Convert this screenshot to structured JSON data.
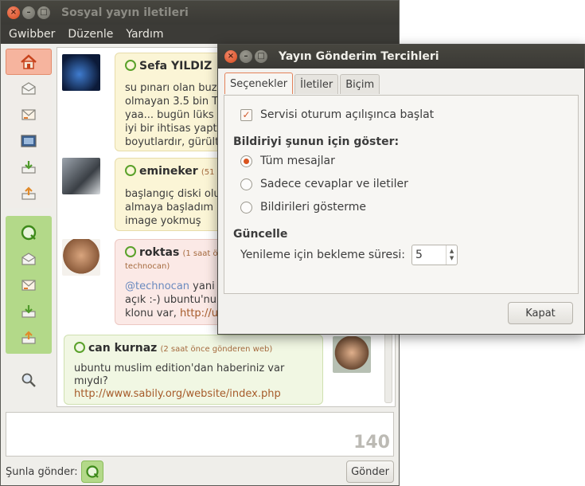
{
  "main_window": {
    "title": "Sosyal yayın iletileri",
    "menu": [
      "Gwibber",
      "Düzenle",
      "Yardım"
    ]
  },
  "messages": [
    {
      "name": "Sefa YILDIZ",
      "meta": "",
      "lines": [
        "su pınarı olan buz",
        "olmayan 3.5 bin T",
        "yaa... bugün lüks",
        "iyi bir ihtisas yapt",
        "boyutlardır, gürült"
      ]
    },
    {
      "name": "emineker",
      "meta": "(51",
      "lines": [
        "başlangıç diski olu",
        "almaya başladım",
        "image yokmuş"
      ]
    },
    {
      "name": "roktas",
      "meta": "(1 saat ö",
      "meta2": "technocan)",
      "lines": [
        "@technocan yani",
        "açık :-) ubuntu'nu",
        "klonu var, http://u"
      ],
      "mention": "@technocan",
      "link_prefix": "klonu var, ",
      "link": "http://u"
    },
    {
      "name": "can kurnaz",
      "meta": "(2 saat önce gönderen web)",
      "lines": [
        "ubuntu muslim edition'dan haberiniz var",
        "mıydı?"
      ],
      "link": "http://www.sabily.org/website/index.php"
    }
  ],
  "compose": {
    "counter": "140"
  },
  "send": {
    "label": "Şunla gönder:",
    "button": "Gönder"
  },
  "dialog": {
    "title": "Yayın Gönderim Tercihleri",
    "tabs": [
      "Seçenekler",
      "İletiler",
      "Biçim"
    ],
    "autostart_label": "Servisi oturum açılışınca başlat",
    "notify_heading": "Bildiriyi şunun için göster:",
    "radio_options": [
      "Tüm mesajlar",
      "Sadece cevaplar ve iletiler",
      "Bildirileri gösterme"
    ],
    "update_heading": "Güncelle",
    "interval_label": "Yenileme için bekleme süresi:",
    "interval_value": "5",
    "close_button": "Kapat"
  },
  "icons": {
    "window_close": "×",
    "window_min": "–",
    "window_max": "□"
  },
  "colors": {
    "accent": "#d9531e",
    "green": "#b3d989"
  }
}
